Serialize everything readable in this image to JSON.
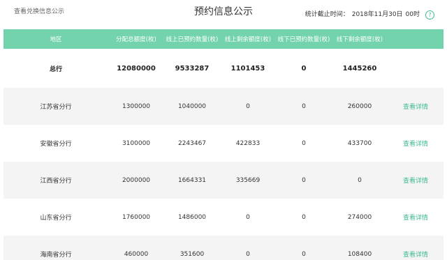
{
  "header": {
    "left_link": "查看兑换信息公示",
    "title": "预约信息公示",
    "stats_label": "统计截止时间：",
    "stats_date": "2018年11月30日",
    "stats_time": "00时",
    "help_icon_glyph": "?"
  },
  "colors": {
    "header_bg": "#72d3ac",
    "accent": "#3dbb8f",
    "row_alt_bg": "#f4f4f4"
  },
  "table": {
    "columns": [
      "地区",
      "分配总额度(枚)",
      "线上已预约数量(枚)",
      "线上剩余额度(枚)",
      "线下已预约数量(枚)",
      "线下剩余额度(枚)",
      ""
    ],
    "total": {
      "region": "总行",
      "allocated": "12080000",
      "online_reserved": "9533287",
      "online_remaining": "1101453",
      "offline_reserved": "0",
      "offline_remaining": "1445260"
    },
    "rows": [
      {
        "region": "江苏省分行",
        "allocated": "1300000",
        "online_reserved": "1040000",
        "online_remaining": "0",
        "offline_reserved": "0",
        "offline_remaining": "260000",
        "action": "查看详情"
      },
      {
        "region": "安徽省分行",
        "allocated": "3100000",
        "online_reserved": "2243467",
        "online_remaining": "422833",
        "offline_reserved": "0",
        "offline_remaining": "433700",
        "action": "查看详情"
      },
      {
        "region": "江西省分行",
        "allocated": "2000000",
        "online_reserved": "1664331",
        "online_remaining": "335669",
        "offline_reserved": "0",
        "offline_remaining": "0",
        "action": "查看详情"
      },
      {
        "region": "山东省分行",
        "allocated": "1760000",
        "online_reserved": "1486000",
        "online_remaining": "0",
        "offline_reserved": "0",
        "offline_remaining": "274000",
        "action": "查看详情"
      },
      {
        "region": "海南省分行",
        "allocated": "460000",
        "online_reserved": "351600",
        "online_remaining": "0",
        "offline_reserved": "0",
        "offline_remaining": "108400",
        "action": "查看详情"
      }
    ]
  }
}
